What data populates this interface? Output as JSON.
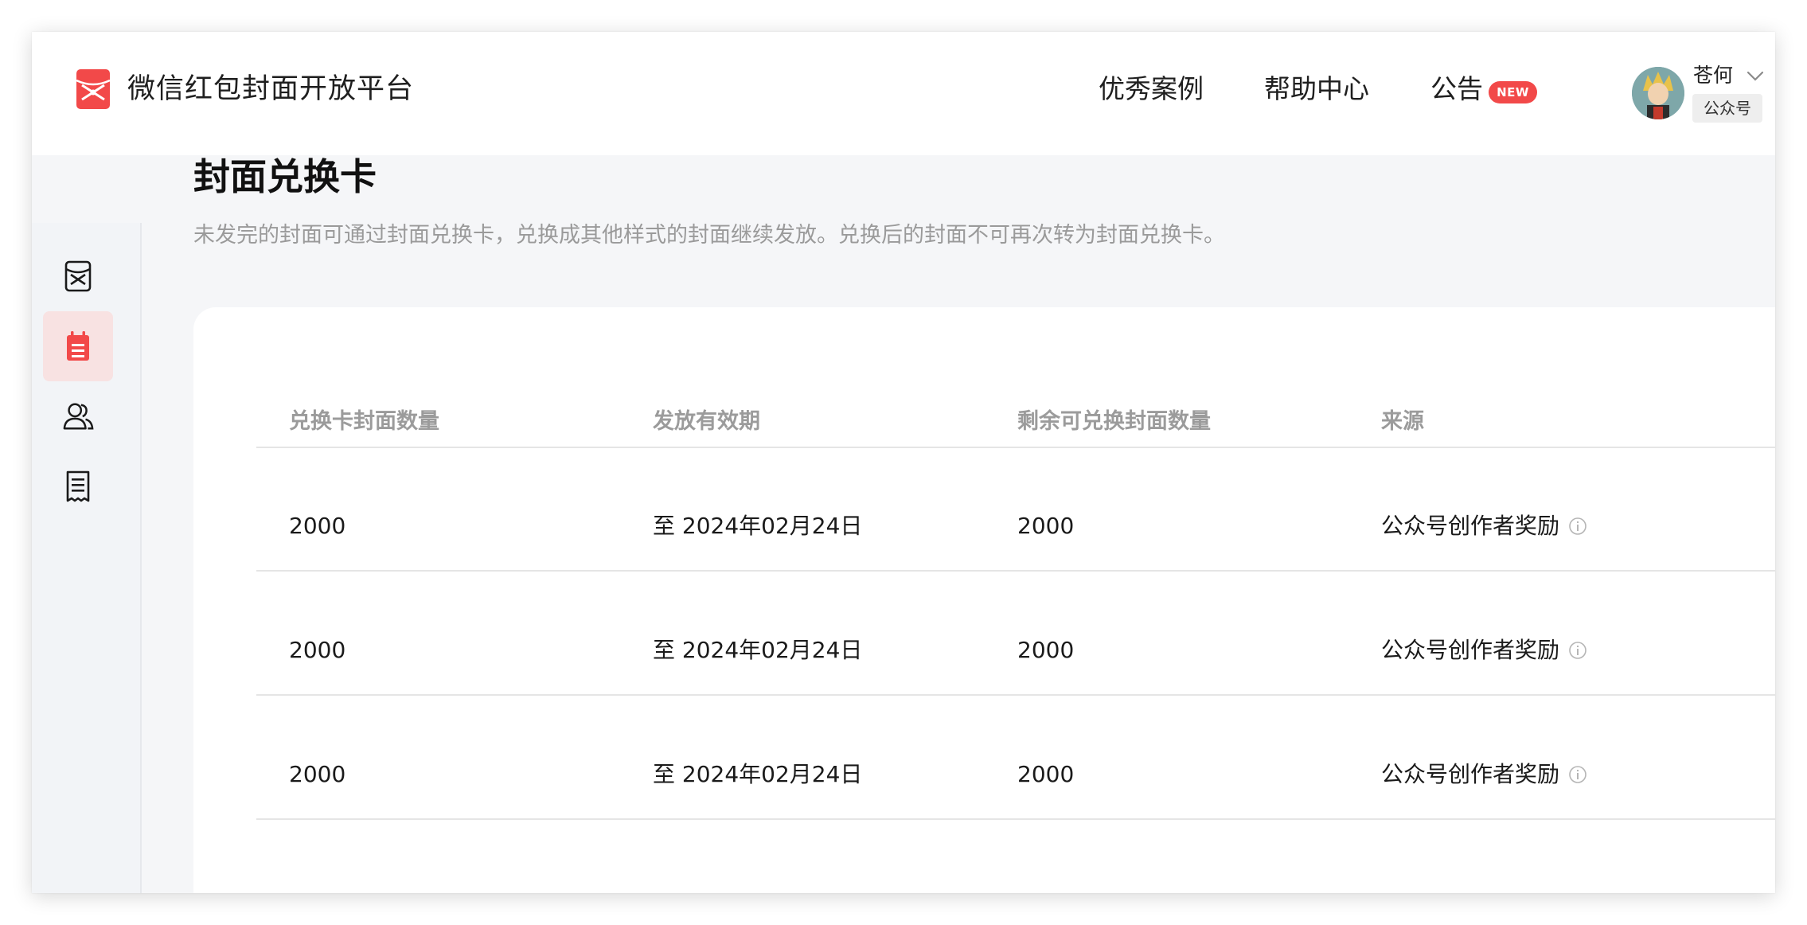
{
  "header": {
    "brand": "微信红包封面开放平台",
    "nav": [
      {
        "label": "优秀案例"
      },
      {
        "label": "帮助中心"
      },
      {
        "label": "公告",
        "badge": "NEW"
      }
    ],
    "user": {
      "name": "苍何",
      "account_type": "公众号"
    },
    "logo_icon": "red-envelope-icon",
    "accent_color": "#f24949"
  },
  "sidebar": {
    "items": [
      {
        "icon": "envelope-cover-icon",
        "active": false
      },
      {
        "icon": "calendar-card-icon",
        "active": true
      },
      {
        "icon": "users-icon",
        "active": false
      },
      {
        "icon": "receipt-icon",
        "active": false
      }
    ]
  },
  "page": {
    "title": "封面兑换卡",
    "description": "未发完的封面可通过封面兑换卡，兑换成其他样式的封面继续发放。兑换后的封面不可再次转为封面兑换卡。"
  },
  "table": {
    "columns": [
      "兑换卡封面数量",
      "发放有效期",
      "剩余可兑换封面数量",
      "来源"
    ],
    "rows": [
      [
        "2000",
        "至 2024年02月24日",
        "2000",
        "公众号创作者奖励"
      ],
      [
        "2000",
        "至 2024年02月24日",
        "2000",
        "公众号创作者奖励"
      ],
      [
        "2000",
        "至 2024年02月24日",
        "2000",
        "公众号创作者奖励"
      ]
    ]
  }
}
